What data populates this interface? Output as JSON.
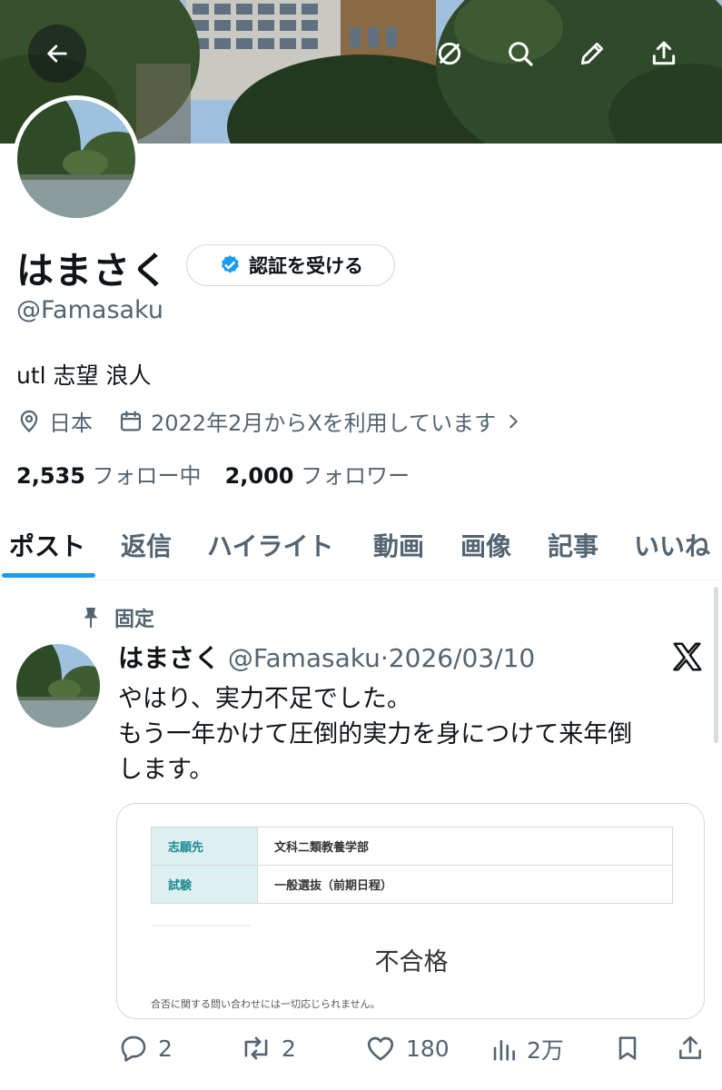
{
  "profile": {
    "name": "はまさく",
    "verify_label": "認証を受ける",
    "handle": "@Famasaku",
    "bio": "utl 志望 浪人",
    "location": "日本",
    "joined": "2022年2月からXを利用しています",
    "following_count": "2,535",
    "following_label": "フォロー中",
    "followers_count": "2,000",
    "followers_label": "フォロワー"
  },
  "tabs": [
    {
      "label": "ポスト",
      "active": true
    },
    {
      "label": "返信"
    },
    {
      "label": "ハイライト"
    },
    {
      "label": "動画"
    },
    {
      "label": "画像"
    },
    {
      "label": "記事"
    },
    {
      "label": "いいね"
    }
  ],
  "tweet": {
    "pinned_label": "固定",
    "name": "はまさく",
    "handle": "@Famasaku",
    "separator": "·",
    "date": "2026/03/10",
    "text_line1": "やはり、実力不足でした。",
    "text_line2": "もう一年かけて圧倒的実力を身につけて来年倒",
    "text_line3": "します。",
    "media": {
      "row1_header": "志願先",
      "row1_value": "文科二類教養学部",
      "row2_header": "試験",
      "row2_value": "一般選抜（前期日程）",
      "result": "不合格",
      "note": "合否に関する問い合わせには一切応じられません。"
    },
    "replies": "2",
    "reposts": "2",
    "likes": "180",
    "views": "2万"
  },
  "colors": {
    "accent": "#1d9bf0",
    "text_primary": "#0f1419",
    "text_secondary": "#536471",
    "border": "#cfd9de",
    "table_header_bg": "#dcf0ef"
  },
  "icons": {
    "back": "arrow-left-icon",
    "grok": "grok-icon",
    "search": "search-icon",
    "edit": "pencil-icon",
    "share": "upload-icon",
    "verified": "verified-badge-icon",
    "location": "location-pin-icon",
    "calendar": "calendar-icon",
    "pin": "pin-icon",
    "x_logo": "x-logo-icon",
    "reply": "reply-icon",
    "repost": "repost-icon",
    "like": "heart-icon",
    "views": "views-icon",
    "bookmark": "bookmark-icon"
  }
}
